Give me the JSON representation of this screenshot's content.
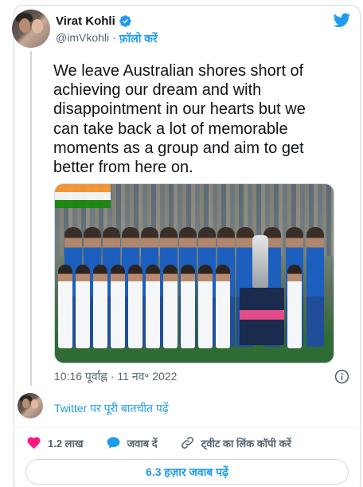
{
  "author": {
    "name": "Virat Kohli",
    "handle": "@imVkohli",
    "separator": "·",
    "follow_label": "फ़ॉलो करें"
  },
  "tweet": {
    "text": "We leave Australian shores short of achieving our dream and with disappointment in our hearts but we can take back a lot of memorable moments as a group and aim to get better from here on.",
    "timestamp": "10:16 पूर्वाह्न · 11 नव॰ 2022"
  },
  "reply_prompt": {
    "label": "Twitter पर पूरी बातचीत पढ़ें"
  },
  "actions": {
    "likes": "1.2 लाख",
    "reply_label": "जवाब दें",
    "copy_link_label": "ट्वीट का लिंक कॉपी करें"
  },
  "replies_button": {
    "label": "6.3 हज़ार जवाब पढ़ें"
  },
  "colors": {
    "accent": "#1d9bf0",
    "like": "#f91880",
    "text": "#0f1419",
    "muted": "#536471"
  },
  "icons": [
    "twitter-bird-icon",
    "verified-badge-icon",
    "info-icon",
    "heart-icon",
    "reply-bubble-icon",
    "link-icon"
  ]
}
